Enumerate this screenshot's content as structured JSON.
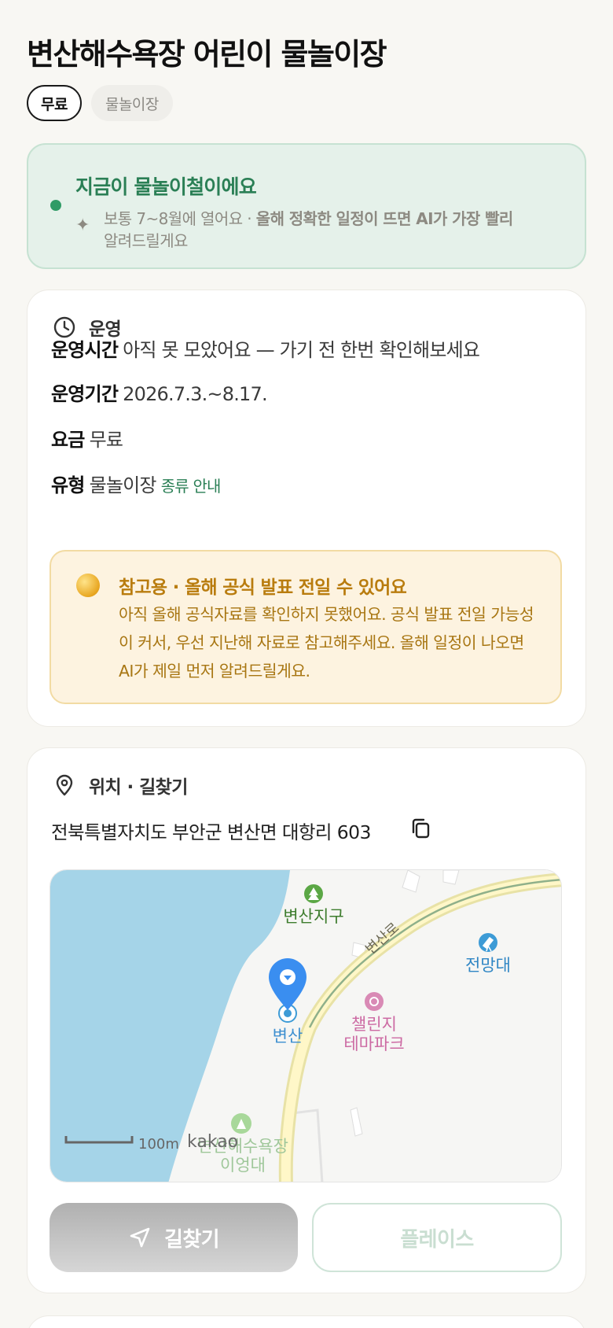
{
  "page": {
    "title": "변산해수욕장 어린이 물놀이장"
  },
  "chips": {
    "price": "무료",
    "type": "물놀이장"
  },
  "season": {
    "title": "지금이 물놀이철이에요",
    "desc_plain": "보통 7~8월에 열어요 · ",
    "desc_bold": "올해 정확한 일정이 뜨면 AI가 가장 빨리",
    "desc_tail": "알려드릴게요",
    "accent_color": "#2f9b66"
  },
  "operation": {
    "section_label": "운영",
    "icon": "clock-icon",
    "hours_key": "운영시간",
    "hours_value": "아직 못 모았어요 — 가기 전 한번 확인해보세요",
    "period_key": "운영기간",
    "period_value": "2026.7.3.~8.17.",
    "fee_key": "요금",
    "fee_value": "무료",
    "type_key": "유형",
    "type_value": "물놀이장",
    "type_link": "종류 안내"
  },
  "notice": {
    "title": "참고용 · 올해 공식 발표 전일 수 있어요",
    "body": "아직 올해 공식자료를 확인하지 못했어요. 공식 발표 전일 가능성이 커서, 우선 지난해 자료로 참고해주세요. 올해 일정이 나오면 AI가 제일 먼저 알려드릴게요.",
    "accent_color": "#b97c0e"
  },
  "location": {
    "section_label": "위치 · 길찾기",
    "icon": "pin-icon",
    "address": "전북특별자치도 부안군 변산면 대항리 603",
    "copy_icon": "copy-icon"
  },
  "map": {
    "labels": {
      "park": "변산지구",
      "road": "변산로",
      "observatory": "전망대",
      "themepark_line1": "챌린지",
      "themepark_line2": "테마파크",
      "marker": "변산",
      "beach": "변산해수욕장",
      "scale": "100m",
      "brand": "kakao"
    }
  },
  "buttons": {
    "route": "길찾기",
    "place": "플레이스"
  }
}
